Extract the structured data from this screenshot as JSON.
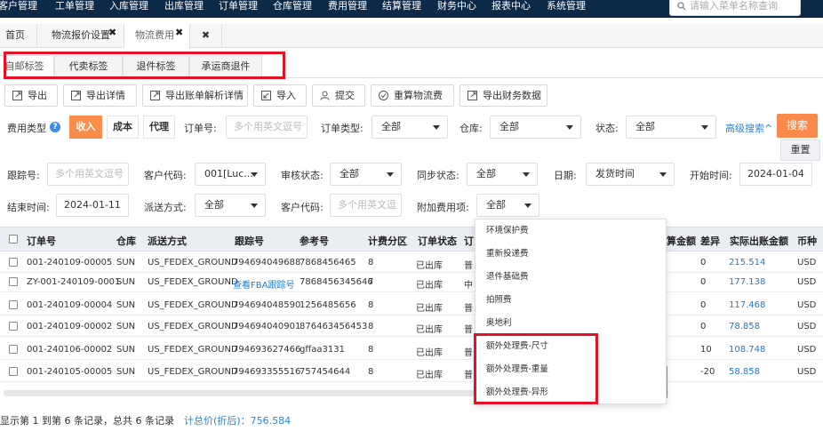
{
  "topnav": {
    "items": [
      "客户管理",
      "工单管理",
      "入库管理",
      "出库管理",
      "订单管理",
      "仓库管理",
      "费用管理",
      "结算管理",
      "财务中心",
      "报表中心",
      "系统管理"
    ],
    "search_placeholder": "请输入菜单名称查询"
  },
  "page_tabs": {
    "home": "首页",
    "tab1": "物流报价设置",
    "tab2": "物流费用",
    "close_symbol": "✖"
  },
  "sub_tabs": [
    "自邮标签",
    "代卖标签",
    "退件标签",
    "承运商退件"
  ],
  "toolbar": [
    "导出",
    "导出详情",
    "导出账单解析详情",
    "导入",
    "提交",
    "重算物流费",
    "导出财务数据"
  ],
  "filters": {
    "fee_type_label": "费用类型",
    "help_symbol": "?",
    "fee_type_options": [
      "收入",
      "成本",
      "代理"
    ],
    "order_no_label": "订单号:",
    "order_no_placeholder": "多个用英文逗号",
    "order_type_label": "订单类型:",
    "order_type_value": "全部",
    "warehouse_label": "仓库:",
    "warehouse_value": "全部",
    "status_label": "状态:",
    "status_value": "全部",
    "advanced_search": "高级搜索^",
    "search_button": "搜索",
    "reset_button": "重置",
    "tracking_label": "跟踪号:",
    "tracking_placeholder": "多个用英文逗号",
    "customer_code_label": "客户代码:",
    "customer_code_value": "001[Luc...",
    "audit_status_label": "审核状态:",
    "audit_status_value": "全部",
    "sync_status_label": "同步状态:",
    "sync_status_value": "全部",
    "date_label": "日期:",
    "date_value": "发货时间",
    "start_time_label": "开始时间:",
    "start_time_value": "2024-01-04",
    "end_time_label": "结束时间:",
    "end_time_value": "2024-01-11",
    "delivery_label": "派送方式:",
    "delivery_value": "全部",
    "customer_code2_label": "客户代码:",
    "customer_code2_placeholder": "多个用英文逗",
    "extra_fee_label": "附加费用项:",
    "extra_fee_value": "全部"
  },
  "table": {
    "headers": [
      "订单号",
      "仓库",
      "派送方式",
      "跟踪号",
      "参考号",
      "计费分区",
      "订单状态",
      "订",
      "算金额",
      "差异",
      "实际出账金额",
      "币种"
    ],
    "rows": [
      {
        "order": "001-240109-00005",
        "wh": "SUN",
        "ship": "US_FEDEX_GROUND",
        "track": "794694049688",
        "ref": "7868456465",
        "zone": "8",
        "status": "已出库",
        "c8": "普",
        "diff": "0",
        "amount": "215.514",
        "cur": "USD"
      },
      {
        "order": "ZY-001-240109-0001",
        "wh": "SUN",
        "ship": "US_FEDEX_GROUND",
        "track": "查看FBA跟踪号",
        "ref": "7868456345646",
        "zone": "7",
        "status": "已出库",
        "c8": "中",
        "diff": "0",
        "amount": "177.138",
        "cur": "USD"
      },
      {
        "order": "001-240109-00004",
        "wh": "SUN",
        "ship": "US_FEDEX_GROUND",
        "track": "794694048590",
        "ref": "1256485656",
        "zone": "8",
        "status": "已出库",
        "c8": "普",
        "diff": "0",
        "amount": "117.468",
        "cur": "USD"
      },
      {
        "order": "001-240109-00002",
        "wh": "SUN",
        "ship": "US_FEDEX_GROUND",
        "track": "794694040901",
        "ref": "876463456453",
        "zone": "8",
        "status": "已出库",
        "c8": "普",
        "diff": "0",
        "amount": "78.858",
        "cur": "USD"
      },
      {
        "order": "001-240106-00002",
        "wh": "SUN",
        "ship": "US_FEDEX_GROUND",
        "track": "794693627466",
        "ref": "gffaa3131",
        "zone": "8",
        "status": "已出库",
        "c8": "普",
        "diff": "10",
        "amount": "108.748",
        "cur": "USD"
      },
      {
        "order": "001-240105-00005",
        "wh": "SUN",
        "ship": "US_FEDEX_GROUND",
        "track": "794693355516",
        "ref": "757454644",
        "zone": "8",
        "status": "已出库",
        "c8": "普",
        "diff": "-20",
        "amount": "58.858",
        "cur": "USD"
      }
    ]
  },
  "dropdown": {
    "items": [
      "环境保护费",
      "重新投递费",
      "退件基础费",
      "拍照费",
      "奥地利",
      "额外处理费-尺寸",
      "额外处理费-重量",
      "额外处理费-异形"
    ]
  },
  "footer": {
    "records": "显示第 1 到第 6 条记录，总共 6 条记录",
    "total": "计总价(折后)：756.584"
  },
  "colors": {
    "nav_bg": "#0c2a47",
    "accent_orange": "#fb8c4a",
    "link_blue": "#1f7ad1",
    "highlight_red": "#e81123"
  }
}
